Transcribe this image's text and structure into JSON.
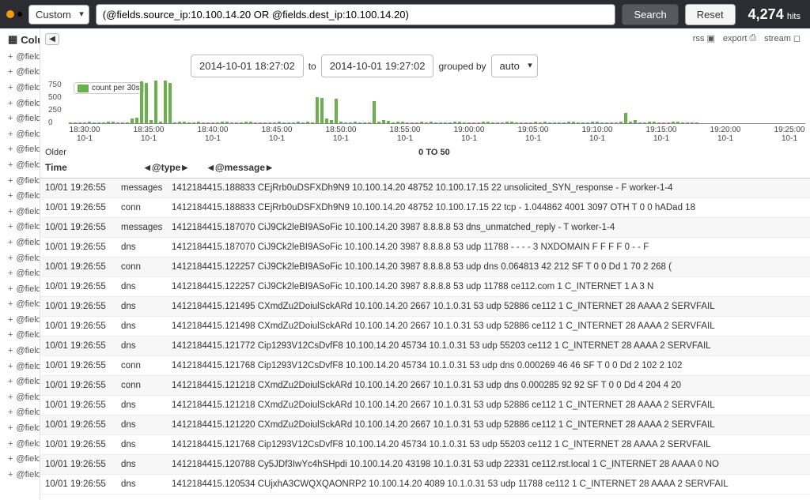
{
  "topbar": {
    "mode": "Custom",
    "query": "(@fields.source_ip:10.100.14.20 OR @fields.dest_ip:10.100.14.20)",
    "search_label": "Search",
    "reset_label": "Reset",
    "hits_value": "4,274",
    "hits_label": "hits"
  },
  "sidebar": {
    "title": "Columns",
    "fields": [
      "@fields.TTLs",
      "@fields.answers",
      "@fields.conn_state",
      "@fields.dest_ip",
      "@fields.dest_port",
      "@fields.duration",
      "@fields.epochdate",
      "@fields.history",
      "@fields.local_orig",
      "@fields.missed_bytes_orig",
      "@fields.missed_bytes_resp",
      "@fields.name",
      "@fields.notice",
      "@fields.orig_bytes",
      "@fields.orig_ip_bytes",
      "@fields.orig_pkts",
      "@fields.protocol",
      "@fields.qclass_name",
      "@fields.qtype_name",
      "@fields.query",
      "@fields.rcode_name",
      "@fields.rejected",
      "@fields.resp_bytes",
      "@fields.resp_cc",
      "@fields.resp_ip_bytes",
      "@fields.resp_pkts",
      "@fields.service",
      "@fields.source_ip"
    ]
  },
  "toolbar": {
    "rss": "rss",
    "export": "export",
    "stream": "stream"
  },
  "timebar": {
    "from": "2014-10-01 18:27:02",
    "to_label": "to",
    "to": "2014-10-01 19:27:02",
    "grouped_by_label": "grouped by",
    "grouped_by": "auto"
  },
  "chart_data": {
    "type": "bar",
    "title": "",
    "legend": "count per 30s",
    "ylabel": "",
    "ylim": [
      0,
      750
    ],
    "yticks": [
      750,
      500,
      250,
      0
    ],
    "xticks": [
      {
        "top": "18:30:00",
        "bot": "10-1"
      },
      {
        "top": "18:35:00",
        "bot": "10-1"
      },
      {
        "top": "18:40:00",
        "bot": "10-1"
      },
      {
        "top": "18:45:00",
        "bot": "10-1"
      },
      {
        "top": "18:50:00",
        "bot": "10-1"
      },
      {
        "top": "18:55:00",
        "bot": "10-1"
      },
      {
        "top": "19:00:00",
        "bot": "10-1"
      },
      {
        "top": "19:05:00",
        "bot": "10-1"
      },
      {
        "top": "19:10:00",
        "bot": "10-1"
      },
      {
        "top": "19:15:00",
        "bot": "10-1"
      },
      {
        "top": "19:20:00",
        "bot": "10-1"
      },
      {
        "top": "19:25:00",
        "bot": "10-1"
      }
    ],
    "values": [
      20,
      10,
      20,
      15,
      30,
      20,
      15,
      20,
      25,
      30,
      20,
      10,
      15,
      80,
      90,
      720,
      690,
      60,
      730,
      30,
      730,
      700,
      20,
      30,
      25,
      20,
      15,
      30,
      20,
      10,
      15,
      20,
      25,
      30,
      20,
      15,
      10,
      25,
      30,
      20,
      10,
      15,
      20,
      10,
      30,
      20,
      15,
      10,
      25,
      20,
      30,
      20,
      450,
      430,
      80,
      60,
      420,
      30,
      15,
      20,
      25,
      10,
      15,
      20,
      380,
      30,
      60,
      40,
      20,
      25,
      30,
      15,
      20,
      10,
      25,
      20,
      30,
      20,
      15,
      10,
      20,
      25,
      30,
      20,
      10,
      15,
      20,
      25,
      30,
      10,
      15,
      20,
      25,
      30,
      20,
      15,
      20,
      10,
      25,
      20,
      30,
      20,
      10,
      15,
      20,
      25,
      30,
      10,
      15,
      20,
      25,
      30,
      20,
      15,
      20,
      10,
      25,
      180,
      30,
      60,
      20,
      10,
      25,
      30,
      15,
      20,
      10,
      25,
      30,
      20,
      15,
      20,
      10
    ]
  },
  "pager": {
    "older": "Older",
    "range": "0 TO 50"
  },
  "table": {
    "headers": {
      "time": "Time",
      "type": "@type",
      "message": "@message"
    },
    "rows": [
      {
        "time": "10/01 19:26:55",
        "type": "messages",
        "msg": "1412184415.188833   CEjRrb0uDSFXDh9N9   10.100.14.20   48752   10.100.17.15   22   unsolicited_SYN_response   -   F   worker-1-4"
      },
      {
        "time": "10/01 19:26:55",
        "type": "conn",
        "msg": "1412184415.188833   CEjRrb0uDSFXDh9N9   10.100.14.20   48752   10.100.17.15   22   tcp   -   1.044862   4001   3097   OTH   T   0   0   hADad   18"
      },
      {
        "time": "10/01 19:26:55",
        "type": "messages",
        "msg": "1412184415.187070   CiJ9Ck2leBI9ASoFic   10.100.14.20   3987   8.8.8.8   53   dns_unmatched_reply   -   T   worker-1-4"
      },
      {
        "time": "10/01 19:26:55",
        "type": "dns",
        "msg": "1412184415.187070   CiJ9Ck2leBI9ASoFic   10.100.14.20   3987   8.8.8.8   53   udp   11788   -   -   -   -   3   NXDOMAIN   F   F   F   F   0   -   -   F"
      },
      {
        "time": "10/01 19:26:55",
        "type": "conn",
        "msg": "1412184415.122257   CiJ9Ck2leBI9ASoFic   10.100.14.20   3987   8.8.8.8   53   udp   dns   0.064813   42   212   SF   T   0   0   Dd   1   70   2   268   ("
      },
      {
        "time": "10/01 19:26:55",
        "type": "dns",
        "msg": "1412184415.122257   CiJ9Ck2leBI9ASoFic   10.100.14.20   3987   8.8.8.8   53   udp   11788   ce112.com                                   1   C_INTERNET   1   A   3   N"
      },
      {
        "time": "10/01 19:26:55",
        "type": "dns",
        "msg": "1412184415.121495   CXmdZu2DoiulSckARd   10.100.14.20   2667   10.1.0.31   53   udp   52886   ce112   1   C_INTERNET   28   AAAA   2   SERVFAIL"
      },
      {
        "time": "10/01 19:26:55",
        "type": "dns",
        "msg": "1412184415.121498   CXmdZu2DoiulSckARd   10.100.14.20   2667   10.1.0.31   53   udp   52886   ce112   1   C_INTERNET   28   AAAA   2   SERVFAIL"
      },
      {
        "time": "10/01 19:26:55",
        "type": "dns",
        "msg": "1412184415.121772   Cip1293V12CsDvfF8   10.100.14.20   45734   10.1.0.31   53   udp   55203   ce112   1   C_INTERNET   28   AAAA   2   SERVFAIL"
      },
      {
        "time": "10/01 19:26:55",
        "type": "conn",
        "msg": "1412184415.121768   Cip1293V12CsDvfF8   10.100.14.20   45734   10.1.0.31   53   udp   dns   0.000269   46   46   SF   T   0   0   Dd   2   102   2   102"
      },
      {
        "time": "10/01 19:26:55",
        "type": "conn",
        "msg": "1412184415.121218   CXmdZu2DoiulSckARd   10.100.14.20   2667   10.1.0.31   53   udp   dns   0.000285   92   92   SF   T   0   0   Dd   4   204   4   20"
      },
      {
        "time": "10/01 19:26:55",
        "type": "dns",
        "msg": "1412184415.121218   CXmdZu2DoiulSckARd   10.100.14.20   2667   10.1.0.31   53   udp   52886   ce112   1   C_INTERNET   28   AAAA   2   SERVFAIL"
      },
      {
        "time": "10/01 19:26:55",
        "type": "dns",
        "msg": "1412184415.121220   CXmdZu2DoiulSckARd   10.100.14.20   2667   10.1.0.31   53   udp   52886   ce112   1   C_INTERNET   28   AAAA   2   SERVFAIL"
      },
      {
        "time": "10/01 19:26:55",
        "type": "dns",
        "msg": "1412184415.121768   Cip1293V12CsDvfF8   10.100.14.20   45734   10.1.0.31   53   udp   55203   ce112   1   C_INTERNET   28   AAAA   2   SERVFAIL"
      },
      {
        "time": "10/01 19:26:55",
        "type": "dns",
        "msg": "1412184415.120788   Cy5JDf3IwYc4hSHpdi   10.100.14.20   43198   10.1.0.31   53   udp   22331   ce112.rst.local   1   C_INTERNET   28   AAAA   0   NO"
      },
      {
        "time": "10/01 19:26:55",
        "type": "dns",
        "msg": "1412184415.120534   CUjxhA3CWQXQAONRP2   10.100.14.20   4089   10.1.0.31   53   udp   11788   ce112   1   C_INTERNET   28   AAAA   2   SERVFAIL"
      }
    ]
  }
}
